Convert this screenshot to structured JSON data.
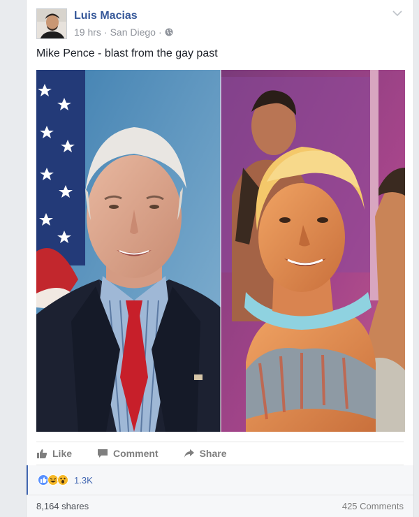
{
  "post": {
    "author": "Luis Macias",
    "time": "19 hrs",
    "location": "San Diego",
    "text": "Mike Pence - blast from the gay past"
  },
  "actions": {
    "like": "Like",
    "comment": "Comment",
    "share": "Share"
  },
  "reactions": {
    "types": [
      "like",
      "haha",
      "wow"
    ],
    "count": "1.3K"
  },
  "footer": {
    "shares": "8,164 shares",
    "comments": "425 Comments"
  },
  "colors": {
    "author_link": "#365899",
    "muted": "#90949c",
    "accent": "#4267b2"
  }
}
